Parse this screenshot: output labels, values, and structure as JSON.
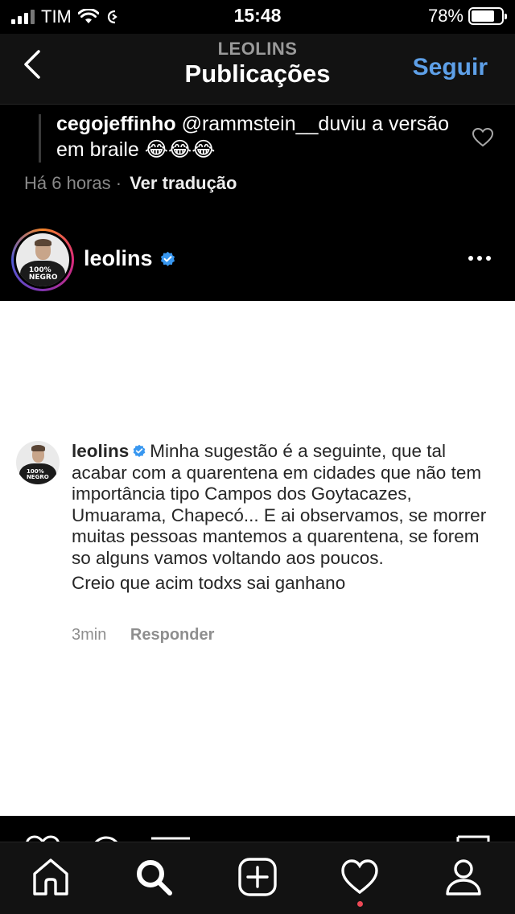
{
  "status_bar": {
    "carrier": "TIM",
    "time": "15:48",
    "battery_percent": "78%",
    "battery_level": 0.78
  },
  "header": {
    "subtitle": "LEOLINS",
    "title": "Publicações",
    "follow_label": "Seguir"
  },
  "quoted_comment": {
    "username": "cegojeffinho",
    "text": "@rammstein__duviu  a versão em braile 😂😂😂",
    "time": "Há 6 horas",
    "separator": "·",
    "translate_label": "Ver tradução"
  },
  "post": {
    "username": "leolins",
    "avatar_shirt_text": "100% NEGRO"
  },
  "image_comment": {
    "username": "leolins",
    "body": "Minha sugestão é a seguinte, que tal acabar com a quarentena em cidades que não tem importância tipo Campos dos Goytacazes, Umuarama, Chapecó... E ai observamos, se morrer muitas pessoas mantemos a quarentena, se forem so alguns vamos voltando aos poucos.",
    "body_line2": "Creio que acim todxs sai ganhano",
    "time": "3min",
    "reply_label": "Responder"
  },
  "tab_bar": {
    "items": [
      "home-icon",
      "search-icon",
      "add-post-icon",
      "activity-heart-icon",
      "profile-icon"
    ],
    "active": "search-icon"
  },
  "colors": {
    "accent_blue": "#5ea0e8",
    "verified_blue": "#3897f0",
    "notification_red": "#ed4956"
  }
}
